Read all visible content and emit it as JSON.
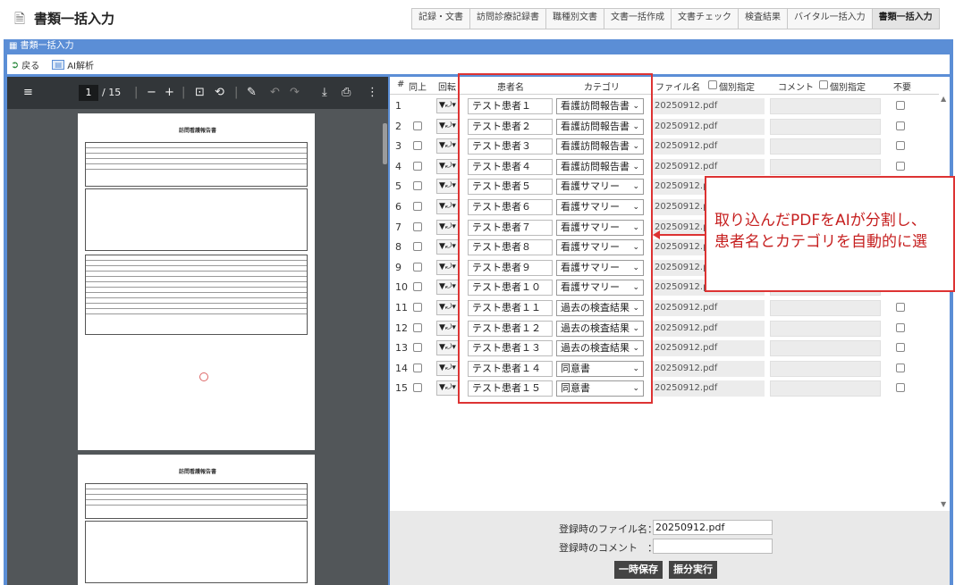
{
  "app": {
    "title": "書類一括入力",
    "icon": "document-icon"
  },
  "nav": {
    "tabs": [
      "記録・文書",
      "訪問診療記録書",
      "職種別文書",
      "文書一括作成",
      "文書チェック",
      "検査結果",
      "バイタル一括入力",
      "書類一括入力"
    ],
    "active": "書類一括入力"
  },
  "panel": {
    "title": "書類一括入力"
  },
  "toolbar": {
    "back_label": "戻る",
    "ai_label": "AI解析"
  },
  "viewer": {
    "page": "1",
    "total": "/ 15",
    "doc_title": "訪問看護報告書"
  },
  "grid": {
    "headers": {
      "num": "#",
      "same": "同上",
      "rotate": "回転",
      "patient": "患者名",
      "category": "カテゴリ",
      "file": "ファイル名",
      "file_individual": "個別指定",
      "comment": "コメント",
      "comment_individual": "個別指定",
      "unneeded": "不要"
    },
    "rows": [
      {
        "num": "1",
        "patient": "テスト患者１",
        "category": "看護訪問報告書",
        "file": "20250912.pdf",
        "show_same": false
      },
      {
        "num": "2",
        "patient": "テスト患者２",
        "category": "看護訪問報告書",
        "file": "20250912.pdf",
        "show_same": true
      },
      {
        "num": "3",
        "patient": "テスト患者３",
        "category": "看護訪問報告書",
        "file": "20250912.pdf",
        "show_same": true
      },
      {
        "num": "4",
        "patient": "テスト患者４",
        "category": "看護訪問報告書",
        "file": "20250912.pdf",
        "show_same": true
      },
      {
        "num": "5",
        "patient": "テスト患者５",
        "category": "看護サマリー",
        "file": "20250912.pdf",
        "show_same": true
      },
      {
        "num": "6",
        "patient": "テスト患者６",
        "category": "看護サマリー",
        "file": "20250912.pdf",
        "show_same": true
      },
      {
        "num": "7",
        "patient": "テスト患者７",
        "category": "看護サマリー",
        "file": "20250912.pdf",
        "show_same": true
      },
      {
        "num": "8",
        "patient": "テスト患者８",
        "category": "看護サマリー",
        "file": "20250912.pdf",
        "show_same": true
      },
      {
        "num": "9",
        "patient": "テスト患者９",
        "category": "看護サマリー",
        "file": "20250912.pdf",
        "show_same": true
      },
      {
        "num": "10",
        "patient": "テスト患者１０",
        "category": "看護サマリー",
        "file": "20250912.pdf",
        "show_same": true
      },
      {
        "num": "11",
        "patient": "テスト患者１１",
        "category": "過去の検査結果",
        "file": "20250912.pdf",
        "show_same": true
      },
      {
        "num": "12",
        "patient": "テスト患者１２",
        "category": "過去の検査結果",
        "file": "20250912.pdf",
        "show_same": true
      },
      {
        "num": "13",
        "patient": "テスト患者１３",
        "category": "過去の検査結果",
        "file": "20250912.pdf",
        "show_same": true
      },
      {
        "num": "14",
        "patient": "テスト患者１４",
        "category": "同意書",
        "file": "20250912.pdf",
        "show_same": true
      },
      {
        "num": "15",
        "patient": "テスト患者１５",
        "category": "同意書",
        "file": "20250912.pdf",
        "show_same": true
      }
    ]
  },
  "callout": {
    "line1": "取り込んだPDFをAIが分割し、",
    "line2": "患者名とカテゴリを自動的に選"
  },
  "footer": {
    "file_label": "登録時のファイル名：",
    "file_value": "20250912.pdf",
    "comment_label": "登録時のコメント　：",
    "comment_value": "",
    "temp_save": "一時保存",
    "execute": "振分実行"
  },
  "colors": {
    "frame": "#5b8ed6",
    "highlight": "#d33333"
  }
}
